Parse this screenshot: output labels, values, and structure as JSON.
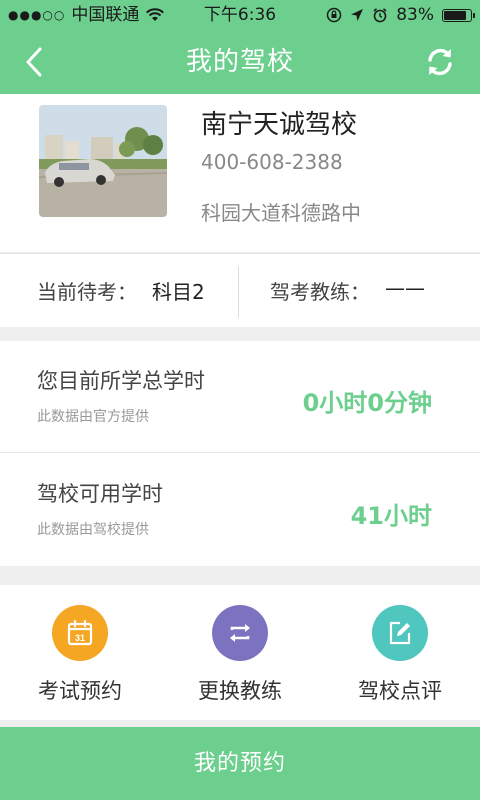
{
  "status_bar": {
    "carrier": "中国联通",
    "time": "下午6:36",
    "battery": "83%",
    "battery_level": 0.83
  },
  "nav": {
    "title": "我的驾校",
    "back_icon": "chevron-left-icon",
    "refresh_icon": "refresh-icon"
  },
  "school": {
    "name": "南宁天诚驾校",
    "phone": "400-608-2388",
    "address": "科园大道科德路中"
  },
  "exam": {
    "pending_label": "当前待考：",
    "pending_value": "科目2",
    "coach_label": "驾考教练：",
    "coach_value": "——"
  },
  "hours": [
    {
      "title": "您目前所学总学时",
      "note": "此数据由官方提供",
      "value": "0小时0分钟"
    },
    {
      "title": "驾校可用学时",
      "note": "此数据由驾校提供",
      "value": "41小时"
    }
  ],
  "actions": [
    {
      "label": "考试预约",
      "icon": "calendar-icon",
      "color": "#f5a623"
    },
    {
      "label": "更换教练",
      "icon": "swap-icon",
      "color": "#7b73bf"
    },
    {
      "label": "驾校点评",
      "icon": "edit-icon",
      "color": "#4fc6be"
    }
  ],
  "calendar_day": "31",
  "bottom_button": {
    "label": "我的预约"
  },
  "colors": {
    "accent": "#6ccf8e",
    "background": "#efefef"
  }
}
